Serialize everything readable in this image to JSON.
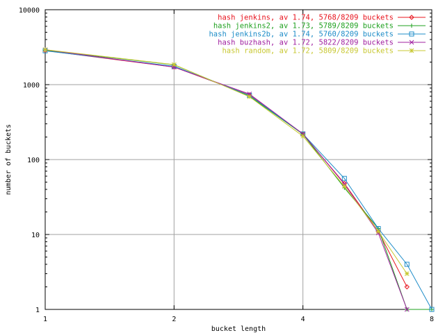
{
  "chart_data": {
    "type": "line",
    "title": "",
    "xlabel": "bucket length",
    "ylabel": "number of buckets",
    "x_scale": "log2",
    "y_scale": "log10",
    "xlim": [
      1,
      8
    ],
    "ylim": [
      1,
      10000
    ],
    "grid": true,
    "legend_position": "top-right",
    "x_ticks": [
      {
        "value": 1,
        "label": "1"
      },
      {
        "value": 2,
        "label": "2"
      },
      {
        "value": 4,
        "label": "4"
      },
      {
        "value": 8,
        "label": "8"
      }
    ],
    "y_ticks": [
      {
        "value": 1,
        "label": "1"
      },
      {
        "value": 10,
        "label": "10"
      },
      {
        "value": 100,
        "label": "100"
      },
      {
        "value": 1000,
        "label": "1000"
      },
      {
        "value": 10000,
        "label": "10000"
      }
    ],
    "series": [
      {
        "name": "hash jenkins, av 1.74, 5768/8209 buckets",
        "color": "#e8141e",
        "marker": "diamond",
        "x": [
          1,
          2,
          3,
          4,
          5,
          6,
          7
        ],
        "y": [
          2850,
          1720,
          730,
          218,
          48,
          11,
          2
        ]
      },
      {
        "name": "hash jenkins2, av 1.73, 5789/8209 buckets",
        "color": "#1ea01e",
        "marker": "plus",
        "x": [
          1,
          2,
          3,
          4,
          5,
          6,
          7,
          8
        ],
        "y": [
          2880,
          1840,
          700,
          218,
          42,
          12,
          1,
          1
        ]
      },
      {
        "name": "hash jenkins2b, av 1.74, 5760/8209 buckets",
        "color": "#1e8cc8",
        "marker": "square",
        "x": [
          1,
          2,
          3,
          4,
          5,
          6,
          7,
          8
        ],
        "y": [
          2830,
          1760,
          720,
          220,
          56,
          12,
          4,
          1
        ]
      },
      {
        "name": "hash buzhash, av 1.72, 5822/8209 buckets",
        "color": "#a020a0",
        "marker": "cross",
        "x": [
          1,
          2,
          3,
          4,
          5,
          6,
          7
        ],
        "y": [
          2930,
          1710,
          750,
          220,
          47,
          10.5,
          1
        ]
      },
      {
        "name": "hash random, av 1.72, 5809/8209 buckets",
        "color": "#c8c832",
        "marker": "star",
        "x": [
          1,
          2,
          3,
          4,
          5,
          6,
          7
        ],
        "y": [
          2930,
          1850,
          690,
          205,
          44,
          11,
          3
        ]
      }
    ]
  }
}
